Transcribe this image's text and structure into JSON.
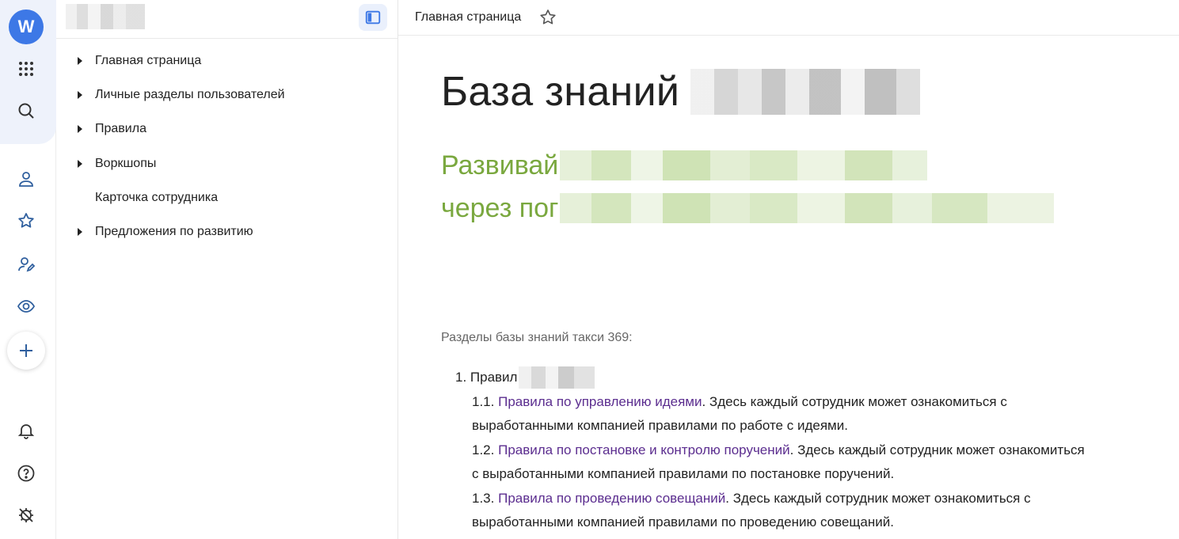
{
  "rail": {
    "avatar_letter": "W",
    "icons": [
      "apps-grid-icon",
      "search-icon",
      "user-icon",
      "star-icon",
      "user-edit-icon",
      "eye-icon",
      "plus-icon",
      "bell-icon",
      "help-icon",
      "bug-settings-icon"
    ]
  },
  "tree": {
    "items": [
      {
        "label": "Главная страница",
        "expandable": true
      },
      {
        "label": "Личные разделы пользователей",
        "expandable": true
      },
      {
        "label": "Правила",
        "expandable": true
      },
      {
        "label": "Воркшопы",
        "expandable": true
      },
      {
        "label": "Карточка сотрудника",
        "expandable": false
      },
      {
        "label": "Предложения по развитию",
        "expandable": true
      }
    ]
  },
  "topbar": {
    "breadcrumb": "Главная страница"
  },
  "page": {
    "title": "База знаний",
    "subtitle_line1": "Развивай",
    "subtitle_line2": "через пог",
    "sections_label": "Разделы базы знаний такси 369:",
    "section1_head": "1. Правил",
    "items": [
      {
        "num": "1.1.",
        "link": "Правила по управлению идеями",
        "line1_rest": ". Здесь каждый сотрудник может ознакомиться с",
        "line2": "выработанными компанией правилами по работе с идеями."
      },
      {
        "num": "1.2.",
        "link": "Правила по постановке и контролю поручений",
        "line1_rest": ". Здесь каждый сотрудник может ознакомиться",
        "line2": "с выработанными компанией правилами по постановке поручений."
      },
      {
        "num": "1.3.",
        "link": "Правила по проведению совещаний",
        "line1_rest": ". Здесь каждый сотрудник может ознакомиться с",
        "line2": "выработанными компанией правилами по проведению совещаний."
      }
    ]
  },
  "colors": {
    "accent_blue": "#3d78e6",
    "subtitle_green": "#7aa83f",
    "link_purple": "#5b2d8f"
  }
}
